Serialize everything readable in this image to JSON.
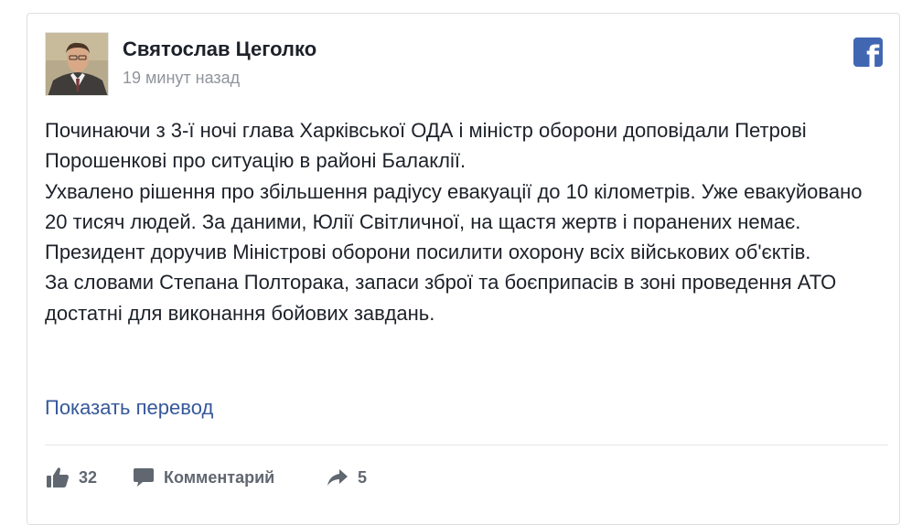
{
  "post": {
    "author": "Святослав Цеголко",
    "timestamp": "19 минут назад",
    "paragraphs": [
      "Починаючи з 3-ї ночі глава Харківської ОДА і міністр оборони доповідали Петрові Порошенкові про ситуацію в районі Балаклії.",
      "Ухвалено рішення про збільшення радіусу евакуації до 10 кілометрів. Уже евакуйовано 20 тисяч людей. За даними, Юлії Світличної, на щастя жертв і поранених немає.",
      "Президент доручив Міністрові оборони посилити охорону всіх військових об'єктів.",
      "За словами Степана Полторака, запаси зброї та боєприпасів в зоні проведення АТО достатні для виконання бойових завдань."
    ],
    "translate_link": "Показать перевод"
  },
  "actions": {
    "like_count": "32",
    "comment_label": "Комментарий",
    "share_count": "5"
  },
  "icons": {
    "brand": "facebook-logo-icon",
    "like": "thumbs-up-icon",
    "comment": "speech-bubble-icon",
    "share": "share-arrow-icon"
  },
  "colors": {
    "facebook_blue": "#4267b2",
    "link": "#365899",
    "text": "#1d2129",
    "muted": "#90949c",
    "action_gray": "#606770"
  }
}
